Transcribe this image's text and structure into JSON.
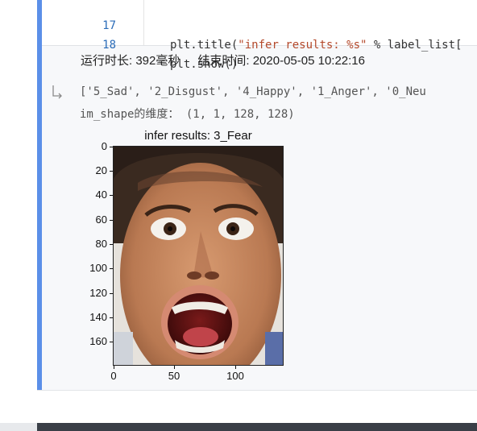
{
  "code": {
    "lines": [
      {
        "number": "17",
        "prefix": "plt.title(",
        "string": "\"infer results: %s\"",
        "suffix": " % label_list["
      },
      {
        "number": "18",
        "prefix": "plt.show()",
        "string": "",
        "suffix": ""
      }
    ]
  },
  "run_meta": {
    "duration": "运行时长: 392毫秒",
    "end_time": "结束时间: 2020-05-05 10:22:16"
  },
  "output": {
    "icon": "output-arrow-icon",
    "lines": [
      "['5_Sad', '2_Disgust', '4_Happy', '1_Anger', '0_Neu",
      "im_shape的维度： (1, 1, 128, 128)"
    ]
  },
  "plot": {
    "title": "infer results: 3_Fear",
    "yticks": [
      "0",
      "20",
      "40",
      "60",
      "80",
      "100",
      "120",
      "140",
      "160"
    ],
    "xticks": [
      "0",
      "50",
      "100"
    ],
    "ytick_values": [
      0,
      20,
      40,
      60,
      80,
      100,
      120,
      140,
      160
    ],
    "xtick_values": [
      0,
      50,
      100
    ],
    "ylim": [
      -0.5,
      179.5
    ],
    "xlim": [
      -0.5,
      139.5
    ],
    "image": "face-image"
  },
  "colors": {
    "cell_accent": "#5b8fe8",
    "line_number": "#2b6cb8",
    "string": "#b4492b"
  }
}
